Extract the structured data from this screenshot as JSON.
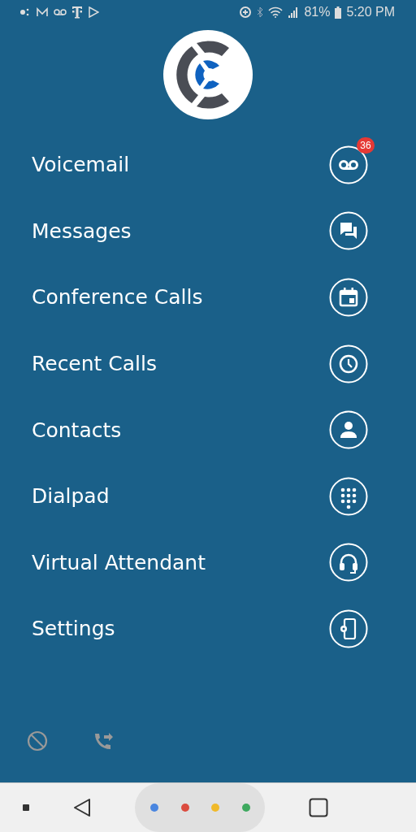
{
  "status_bar": {
    "battery": "81%",
    "time": "5:20 PM"
  },
  "menu": [
    {
      "label": "Voicemail",
      "kind": "voicemail",
      "badge": "36"
    },
    {
      "label": "Messages",
      "kind": "messages"
    },
    {
      "label": "Conference Calls",
      "kind": "calendar"
    },
    {
      "label": "Recent Calls",
      "kind": "clock"
    },
    {
      "label": "Contacts",
      "kind": "person"
    },
    {
      "label": "Dialpad",
      "kind": "dialpad"
    },
    {
      "label": "Virtual Attendant",
      "kind": "headset"
    },
    {
      "label": "Settings",
      "kind": "phonesettings"
    }
  ]
}
